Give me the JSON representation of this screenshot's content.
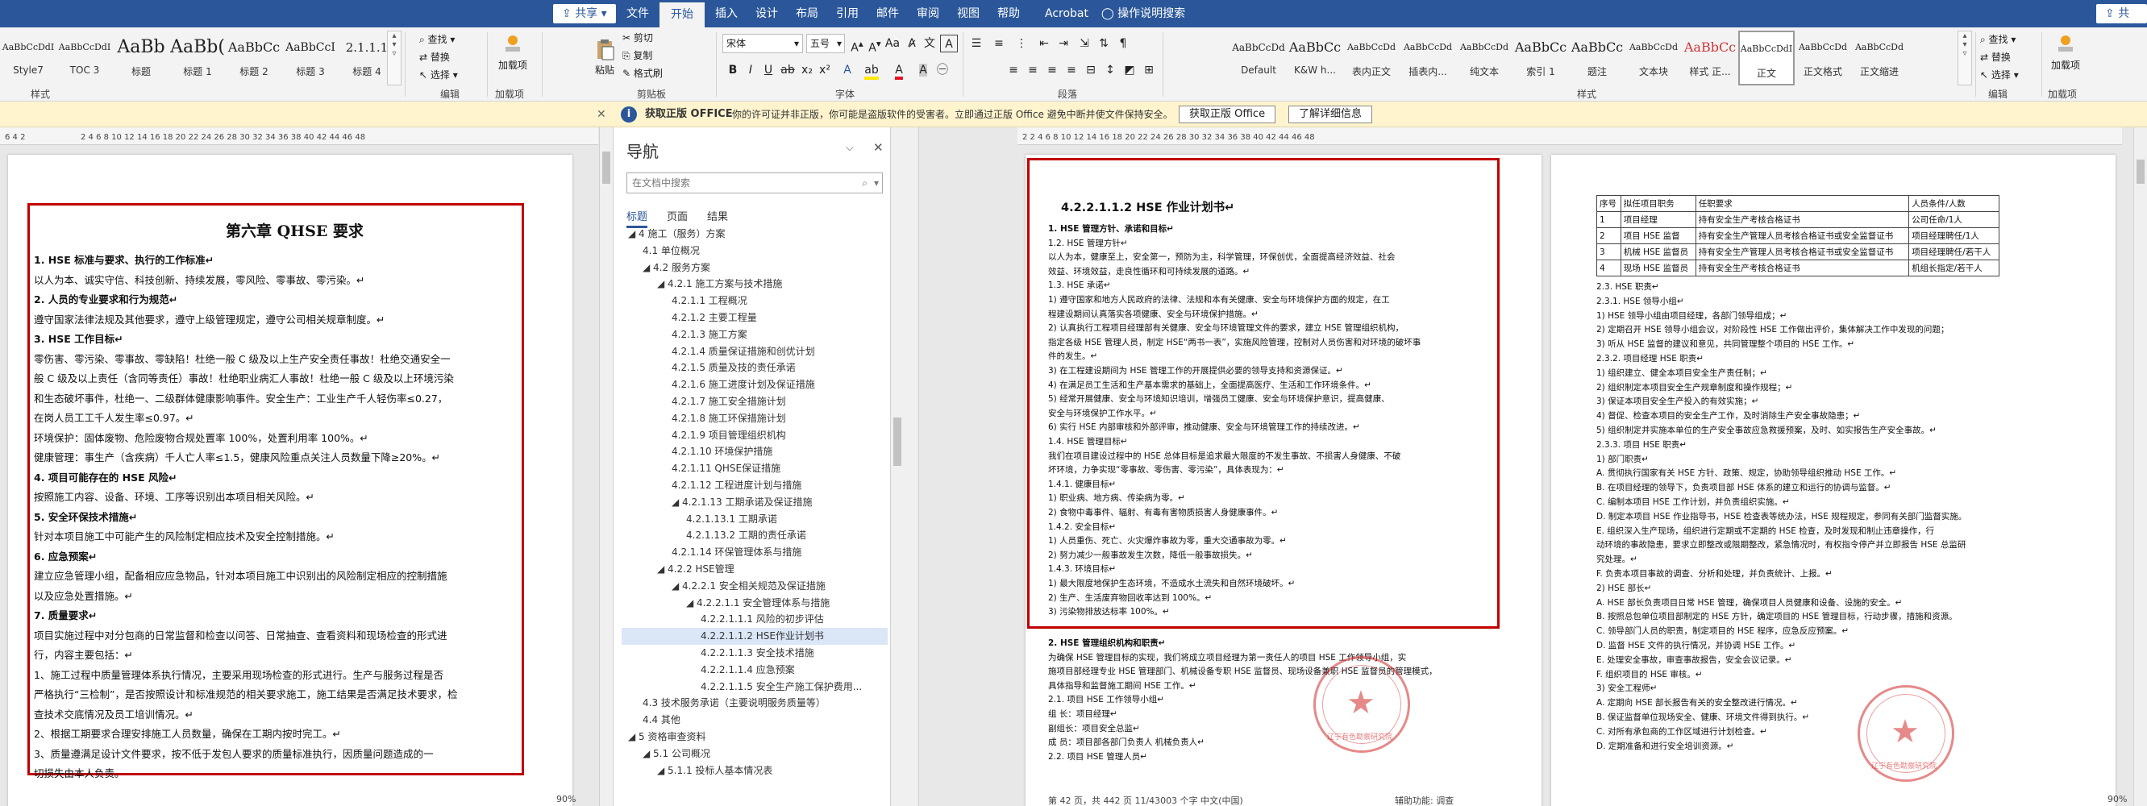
{
  "top": {
    "share_left": "共享",
    "share_right": "共享",
    "tabs": [
      "文件",
      "开始",
      "插入",
      "设计",
      "布局",
      "引用",
      "邮件",
      "审阅",
      "视图",
      "帮助",
      "Acrobat"
    ],
    "active_tab": "开始",
    "tell_me": "操作说明搜索"
  },
  "left_ribbon": {
    "styles": [
      {
        "preview": "AaBbCcDdI",
        "name": "Style7",
        "size": 11
      },
      {
        "preview": "AaBbCcDdI",
        "name": "TOC 3",
        "size": 11
      },
      {
        "preview": "AaBb",
        "name": "标题",
        "size": 22
      },
      {
        "preview": "AaBb(",
        "name": "标题 1",
        "size": 22
      },
      {
        "preview": "AaBbCc",
        "name": "标题 2",
        "size": 16
      },
      {
        "preview": "AaBbCcI",
        "name": "标题 3",
        "size": 14
      },
      {
        "preview": "2.1.1.1",
        "name": "标题 4",
        "size": 15
      }
    ],
    "group_styles": "样式",
    "edit": {
      "find": "查找",
      "replace": "替换",
      "select": "选择",
      "group": "编辑"
    },
    "addin": {
      "label": "加载项",
      "group": "加载项"
    }
  },
  "right_ribbon": {
    "clipboard": {
      "paste": "粘贴",
      "cut": "剪切",
      "copy": "复制",
      "format_painter": "格式刷",
      "group": "剪贴板"
    },
    "font": {
      "name": "宋体",
      "size": "五号",
      "group": "字体"
    },
    "paragraph": {
      "group": "段落"
    },
    "styles": [
      {
        "preview": "AaBbCcDd",
        "name": "Default",
        "color": "#222",
        "size": 12
      },
      {
        "preview": "AaBbCc",
        "name": "K&W h...",
        "color": "#222",
        "size": 16
      },
      {
        "preview": "AaBbCcDd",
        "name": "表内正文",
        "color": "#222",
        "size": 11
      },
      {
        "preview": "AaBbCcDd",
        "name": "插表内...",
        "color": "#222",
        "size": 11
      },
      {
        "preview": "AaBbCcDd",
        "name": "纯文本",
        "color": "#222",
        "size": 11
      },
      {
        "preview": "AaBbCc",
        "name": "索引 1",
        "color": "#222",
        "size": 16
      },
      {
        "preview": "AaBbCc",
        "name": "题注",
        "color": "#222",
        "size": 16
      },
      {
        "preview": "AaBbCcDd",
        "name": "文本块",
        "color": "#222",
        "size": 11
      },
      {
        "preview": "AaBbCc",
        "name": "样式 正...",
        "color": "#d13438",
        "size": 16
      },
      {
        "preview": "AaBbCcDdI",
        "name": "正文",
        "color": "#222",
        "size": 11,
        "selected": true
      },
      {
        "preview": "AaBbCcDd",
        "name": "正文格式",
        "color": "#222",
        "size": 11
      },
      {
        "preview": "AaBbCcDd",
        "name": "正文缩进",
        "color": "#222",
        "size": 11
      }
    ],
    "group_styles": "样式",
    "edit": {
      "find": "查找",
      "replace": "替换",
      "select": "选择",
      "group": "编辑"
    },
    "addin": {
      "label": "加载项",
      "group": "加载项"
    }
  },
  "message": {
    "title": "获取正版 OFFICE",
    "text": "你的许可证并非正版，你可能是盗版软件的受害者。立即通过正版 Office 避免中断并使文件保持安全。",
    "btn1": "获取正版 Office",
    "btn2": "了解详细信息"
  },
  "left_doc": {
    "title": "第六章 QHSE 要求",
    "lines": [
      {
        "t": "1. HSE 标准与要求、执行的工作标准↵",
        "b": true
      },
      {
        "t": "以人为本、诚实守信、科技创新、持续发展，零风险、零事故、零污染。↵"
      },
      {
        "t": "2. 人员的专业要求和行为规范↵",
        "b": true
      },
      {
        "t": "遵守国家法律法规及其他要求，遵守上级管理规定，遵守公司相关规章制度。↵"
      },
      {
        "t": "3. HSE 工作目标↵",
        "b": true
      },
      {
        "t": "零伤害、零污染、零事故、零缺陷！杜绝一般 C 级及以上生产安全责任事故！杜绝交通安全一"
      },
      {
        "t": "般 C 级及以上责任（含同等责任）事故！杜绝职业病汇人事故！杜绝一般 C 级及以上环境污染"
      },
      {
        "t": "和生态破坏事件，杜绝一、二级群体健康影响事件。安全生产：工业生产千人轻伤率≤0.27，"
      },
      {
        "t": "在岗人员工工千人发生率≤0.97。↵"
      },
      {
        "t": "环境保护：固体废物、危险废物合规处置率 100%，处置利用率 100%。↵"
      },
      {
        "t": "健康管理：事生产（含疾病）千人亡人率≤1.5，健康风险重点关注人员数量下降≥20%。↵"
      },
      {
        "t": "4. 项目可能存在的 HSE 风险↵",
        "b": true
      },
      {
        "t": "按照施工内容、设备、环境、工序等识别出本项目相关风险。↵"
      },
      {
        "t": "5. 安全环保技术措施↵",
        "b": true
      },
      {
        "t": "针对本项目施工中可能产生的风险制定相应技术及安全控制措施。↵"
      },
      {
        "t": "6. 应急预案↵",
        "b": true
      },
      {
        "t": "建立应急管理小组，配备相应应急物品，针对本项目施工中识别出的风险制定相应的控制措施"
      },
      {
        "t": "以及应急处置措施。↵"
      },
      {
        "t": "7. 质量要求↵",
        "b": true
      },
      {
        "t": "项目实施过程中对分包商的日常监督和检查以问答、日常抽查、查看资料和现场检查的形式进"
      },
      {
        "t": "行，内容主要包括：↵"
      },
      {
        "t": "1、施工过程中质量管理体系执行情况，主要采用现场检查的形式进行。生产与服务过程是否"
      },
      {
        "t": "严格执行“三检制”，是否按照设计和标准规范的相关要求施工，施工结果是否满足技术要求，检"
      },
      {
        "t": "查技术交底情况及员工培训情况。↵"
      },
      {
        "t": "2、根据工期要求合理安排施工人员数量，确保在工期内按时完工。↵"
      },
      {
        "t": "3、质量遵满足设计文件要求，按不低于发包人要求的质量标准执行，因质量问题造成的一"
      },
      {
        "t": "切损失由本人负责。"
      }
    ]
  },
  "nav": {
    "title": "导航",
    "search_placeholder": "在文档中搜索",
    "tabs": [
      "标题",
      "页面",
      "结果"
    ],
    "items": [
      {
        "t": "◢ 4 施工（服务）方案",
        "lvl": 0
      },
      {
        "t": "4.1 单位概况",
        "lvl": 1
      },
      {
        "t": "◢ 4.2 服务方案",
        "lvl": 1
      },
      {
        "t": "◢ 4.2.1 施工方案与技术措施",
        "lvl": 2
      },
      {
        "t": "4.2.1.1 工程概况",
        "lvl": 3
      },
      {
        "t": "4.2.1.2 主要工程量",
        "lvl": 3
      },
      {
        "t": "4.2.1.3 施工方案",
        "lvl": 3
      },
      {
        "t": "4.2.1.4 质量保证措施和创优计划",
        "lvl": 3
      },
      {
        "t": "4.2.1.5 质量及技的责任承诺",
        "lvl": 3
      },
      {
        "t": "4.2.1.6 施工进度计划及保证措施",
        "lvl": 3
      },
      {
        "t": "4.2.1.7 施工安全措施计划",
        "lvl": 3
      },
      {
        "t": "4.2.1.8 施工环保措施计划",
        "lvl": 3
      },
      {
        "t": "4.2.1.9 项目管理组织机构",
        "lvl": 3
      },
      {
        "t": "4.2.1.10 环境保护措施",
        "lvl": 3
      },
      {
        "t": "4.2.1.11 QHSE保证措施",
        "lvl": 3
      },
      {
        "t": "4.2.1.12 工程进度计划与措施",
        "lvl": 3
      },
      {
        "t": "◢ 4.2.1.13 工期承诺及保证措施",
        "lvl": 3
      },
      {
        "t": "4.2.1.13.1 工期承诺",
        "lvl": 4
      },
      {
        "t": "4.2.1.13.2 工期的责任承诺",
        "lvl": 4
      },
      {
        "t": "4.2.1.14 环保管理体系与措施",
        "lvl": 3
      },
      {
        "t": "◢ 4.2.2 HSE管理",
        "lvl": 2
      },
      {
        "t": "◢ 4.2.2.1 安全相关规范及保证措施",
        "lvl": 3
      },
      {
        "t": "◢ 4.2.2.1.1 安全管理体系与措施",
        "lvl": 4
      },
      {
        "t": "4.2.2.1.1.1 风险的初步评估",
        "lvl": 5
      },
      {
        "t": "4.2.2.1.1.2 HSE作业计划书",
        "lvl": 5,
        "sel": true
      },
      {
        "t": "4.2.2.1.1.3 安全技术措施",
        "lvl": 5
      },
      {
        "t": "4.2.2.1.1.4 应急预案",
        "lvl": 5
      },
      {
        "t": "4.2.2.1.1.5 安全生产施工保护费用...",
        "lvl": 5
      },
      {
        "t": "4.3 技术服务承诺（主要说明服务质量等）",
        "lvl": 1
      },
      {
        "t": "4.4 其他",
        "lvl": 1
      },
      {
        "t": "◢ 5 资格审查资料",
        "lvl": 0
      },
      {
        "t": "◢ 5.1 公司概况",
        "lvl": 1
      },
      {
        "t": "◢ 5.1.1 投标人基本情况表",
        "lvl": 2
      }
    ]
  },
  "page_mid": {
    "heading": "4.2.2.1.1.2 HSE 作业计划书↵",
    "lines": [
      {
        "t": "1. HSE 管理方针、承诺和目标↵",
        "b": true
      },
      {
        "t": "1.2. HSE 管理方针↵"
      },
      {
        "t": "以人为本，健康至上，安全第一，预防为主，科学管理，环保创优，全面提高经济效益、社会"
      },
      {
        "t": "效益、环境效益，走良性循环和可持续发展的道路。↵"
      },
      {
        "t": "1.3. HSE 承诺↵"
      },
      {
        "t": "1) 遵守国家和地方人民政府的法律、法规和本有关健康、安全与环境保护方面的规定，在工"
      },
      {
        "t": "程建设期间认真落实各项健康、安全与环境保护措施。↵"
      },
      {
        "t": "2) 认真执行工程项目经理部有关健康、安全与环境管理文件的要求，建立 HSE 管理组织机构，"
      },
      {
        "t": "指定各级 HSE 管理人员，制定 HSE“两书一表”，实施风险管理，控制对人员伤害和对环境的破坏事"
      },
      {
        "t": "件的发生。↵"
      },
      {
        "t": "3) 在工程建设期间为 HSE 管理工作的开展提供必要的领导支持和资源保证。↵"
      },
      {
        "t": "4) 在满足员工生活和生产基本需求的基础上，全面提高医疗、生活和工作环境条件。↵"
      },
      {
        "t": "5) 经常开展健康、安全与环境知识培训，增强员工健康、安全与环境保护意识，提高健康、"
      },
      {
        "t": "安全与环境保护工作水平。↵"
      },
      {
        "t": "6) 实行 HSE 内部审核和外部评审，推动健康、安全与环境管理工作的持续改进。↵"
      },
      {
        "t": "1.4. HSE 管理目标↵"
      },
      {
        "t": "我们在项目建设过程中的 HSE 总体目标是追求最大限度的不发生事故、不损害人身健康、不破"
      },
      {
        "t": "坏环境，力争实现“零事故、零伤害、零污染”，具体表现为：↵"
      },
      {
        "t": "1.4.1. 健康目标↵"
      },
      {
        "t": "1) 职业病、地方病、传染病为零。↵"
      },
      {
        "t": "2) 食物中毒事件、辐射、有毒有害物质损害人身健康事件。↵"
      },
      {
        "t": "1.4.2. 安全目标↵"
      },
      {
        "t": "1) 人员重伤、死亡、火灾爆炸事故为零，重大交通事故为零。↵"
      },
      {
        "t": "2) 努力减少一般事故发生次数，降低一般事故损失。↵"
      },
      {
        "t": "1.4.3. 环境目标↵"
      },
      {
        "t": "1) 最大限度地保护生态环境，不造成水土流失和自然环境破坏。↵"
      },
      {
        "t": "2) 生产、生活废弃物回收率达到 100%。↵"
      },
      {
        "t": "3) 污染物排放达标率 100%。↵"
      }
    ],
    "below": [
      {
        "t": "2. HSE 管理组织机构和职责↵",
        "b": true
      },
      {
        "t": "为确保 HSE 管理目标的实现，我们将成立项目经理为第一责任人的项目 HSE 工作领导小组，实"
      },
      {
        "t": "施项目部经理专业 HSE 管理部门、机械设备专职 HSE 监督员、现场设备兼职 HSE 监督员的管理模式，"
      },
      {
        "t": "具体指导和监督施工期间 HSE 工作。↵"
      },
      {
        "t": "2.1. 项目 HSE 工作领导小组↵"
      },
      {
        "t": "组    长：项目经理↵"
      },
      {
        "t": "副组长：项目安全总监↵"
      },
      {
        "t": "成    员：项目部各部门负责人    机械负责人↵"
      },
      {
        "t": "2.2. 项目 HSE 管理人员↵"
      }
    ]
  },
  "page_right": {
    "table_header": [
      "序号",
      "拟任项目职务",
      "任职要求",
      "人员条件/人数"
    ],
    "table_rows": [
      [
        "1",
        "项目经理",
        "持有安全生产考核合格证书",
        "公司任命/1人"
      ],
      [
        "2",
        "项目 HSE 监督",
        "持有安全生产管理人员考核合格证书或安全监督证书",
        "项目经理聘任/1人"
      ],
      [
        "3",
        "机械 HSE 监督员",
        "持有安全生产管理人员考核合格证书或安全监督证书",
        "项目经理聘任/若干人"
      ],
      [
        "4",
        "现场 HSE 监督员",
        "持有安全生产考核合格证书",
        "机组长指定/若干人"
      ]
    ],
    "lines": [
      {
        "t": "2.3. HSE 职责↵"
      },
      {
        "t": "2.3.1. HSE 领导小组↵"
      },
      {
        "t": "1) HSE 领导小组由项目经理，各部门领导组成；↵"
      },
      {
        "t": "2) 定期召开 HSE 领导小组会议，对阶段性 HSE 工作做出评价，集体解决工作中发现的问题；"
      },
      {
        "t": "3) 听从 HSE 监督的建议和意见，共同管理整个项目的 HSE 工作。↵"
      },
      {
        "t": "2.3.2. 项目经理 HSE 职责↵"
      },
      {
        "t": "1) 组织建立、健全本项目安全生产责任制；↵"
      },
      {
        "t": "2) 组织制定本项目安全生产规章制度和操作规程；↵"
      },
      {
        "t": "3) 保证本项目安全生产投入的有效实施；↵"
      },
      {
        "t": "4) 督促、检查本项目的安全生产工作，及时消除生产安全事故隐患；↵"
      },
      {
        "t": "5) 组织制定并实施本单位的生产安全事故应急救援预案，及时、如实报告生产安全事故。↵"
      },
      {
        "t": "2.3.3. 项目 HSE 职责↵"
      },
      {
        "t": "1) 部门职责↵"
      },
      {
        "t": "A. 贯彻执行国家有关 HSE 方针、政策、规定，协助领导组织推动 HSE 工作。↵"
      },
      {
        "t": "B. 在项目经理的领导下，负责项目部 HSE 体系的建立和运行的协调与监督。↵"
      },
      {
        "t": "C. 编制本项目 HSE 工作计划，并负责组织实施。↵"
      },
      {
        "t": "D. 制定本项目 HSE 作业指导书，HSE 检查表等统办法，HSE 规程规定，参同有关部门监督实施。"
      },
      {
        "t": "E. 组织深入生产现场，组织进行定期或不定期的 HSE 检查，及时发现和制止违章操作，行"
      },
      {
        "t": "动环境的事故隐患，要求立即整改或限期整改，紧急情况时，有权指令停产并立即报告 HSE 总监研"
      },
      {
        "t": "究处理。↵"
      },
      {
        "t": "F. 负责本项目事故的调查、分析和处理，并负责统计、上报。↵"
      },
      {
        "t": "2) HSE 部长↵"
      },
      {
        "t": "A. HSE 部长负责项目日常 HSE 管理，确保项目人员健康和设备、设施的安全。↵"
      },
      {
        "t": "B. 按照总包单位项目部制定的 HSE 方针，确定项目的 HSE 管理目标，行动步骤，措施和资源。"
      },
      {
        "t": "C. 领导部门人员的职责，制定项目的 HSE 程序，应急反应预案。↵"
      },
      {
        "t": "D. 监督 HSE 文件的执行情况，并协调 HSE 工作。↵"
      },
      {
        "t": "E. 处理安全事故，审查事故报告，安全会议记录。↵"
      },
      {
        "t": "F. 组织项目的 HSE 审核。↵"
      },
      {
        "t": "3) 安全工程师↵"
      },
      {
        "t": "A. 定期向 HSE 部长报告有关的安全整改进行情况。↵"
      },
      {
        "t": "B. 保证监督单位现场安全、健康、环境文件得到执行。↵"
      },
      {
        "t": "C. 对所有承包商的工作区域进行计划检查。↵"
      },
      {
        "t": "D. 定期准备和进行安全培训资源。↵"
      }
    ],
    "stamp1_text": "辽宁有色勘察研究院",
    "stamp2_text": "辽宁有色勘察研究院"
  },
  "status": {
    "left": "第 42 页，共 442 页    11/43003 个字    中文(中国)",
    "mid": "辅助功能: 调查",
    "left_zoom": "90%",
    "right_zoom": "90%"
  }
}
